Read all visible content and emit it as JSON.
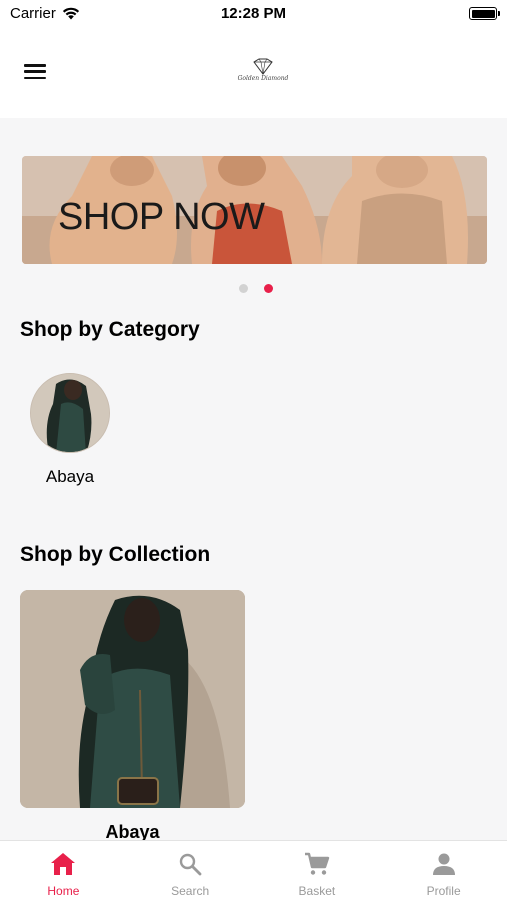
{
  "status_bar": {
    "carrier": "Carrier",
    "time": "12:28 PM"
  },
  "header": {
    "menu_icon": "hamburger-menu-icon",
    "logo_text": "Golden Diamond"
  },
  "banner": {
    "text": "SHOP NOW",
    "pagination": {
      "count": 2,
      "active_index": 1
    }
  },
  "sections": {
    "category": {
      "title": "Shop by Category",
      "items": [
        {
          "label": "Abaya"
        }
      ]
    },
    "collection": {
      "title": "Shop by Collection",
      "items": [
        {
          "label": "Abaya"
        }
      ]
    }
  },
  "tab_bar": {
    "items": [
      {
        "label": "Home",
        "icon": "home-icon",
        "active": true
      },
      {
        "label": "Search",
        "icon": "search-icon",
        "active": false
      },
      {
        "label": "Basket",
        "icon": "cart-icon",
        "active": false
      },
      {
        "label": "Profile",
        "icon": "profile-icon",
        "active": false
      }
    ]
  },
  "colors": {
    "accent": "#e8204a",
    "inactive": "#9a9a9a",
    "background": "#f6f6f7"
  }
}
